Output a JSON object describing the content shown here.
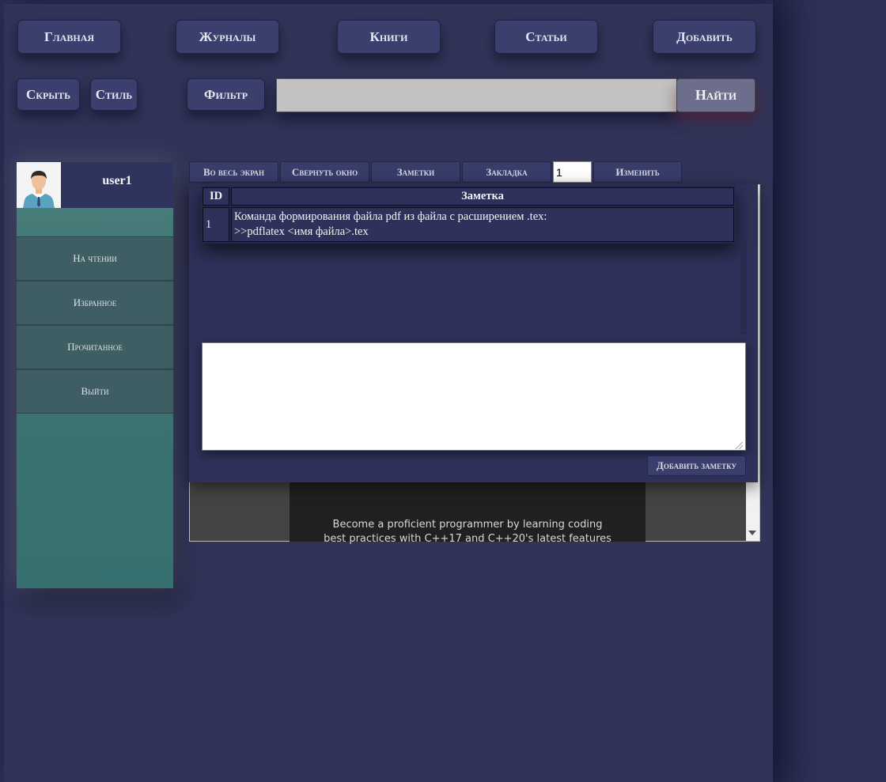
{
  "nav": {
    "home": "Главная",
    "journals": "Журналы",
    "books": "Книги",
    "articles": "Статьи",
    "add": "Добавить"
  },
  "toolbar": {
    "hide": "Скрыть",
    "style": "Стиль",
    "filter": "Фильтр",
    "search_value": "",
    "search_button": "Найти"
  },
  "sidebar": {
    "username": "user1",
    "items": [
      {
        "label": "На чтении"
      },
      {
        "label": "Избранное"
      },
      {
        "label": "Прочитанное"
      },
      {
        "label": "Выйти"
      }
    ]
  },
  "reader_toolbar": {
    "fullscreen": "Во весь экран",
    "minimize": "Свернуть окно",
    "notes": "Заметки",
    "bookmark": "Закладка",
    "page_value": "1",
    "change": "Изменить"
  },
  "notes": {
    "columns": [
      "ID",
      "Заметка"
    ],
    "rows": [
      {
        "id": "1",
        "line1": "Команда формирования файла pdf из файла с расширением .tex:",
        "line2": ">>pdflatex <имя файла>.tex"
      }
    ],
    "textarea_value": "",
    "add_button": "Добавить заметку"
  },
  "viewer": {
    "text_line1": "Become a proficient programmer by learning coding",
    "text_line2": "best practices with C++17 and C++20's latest features"
  }
}
